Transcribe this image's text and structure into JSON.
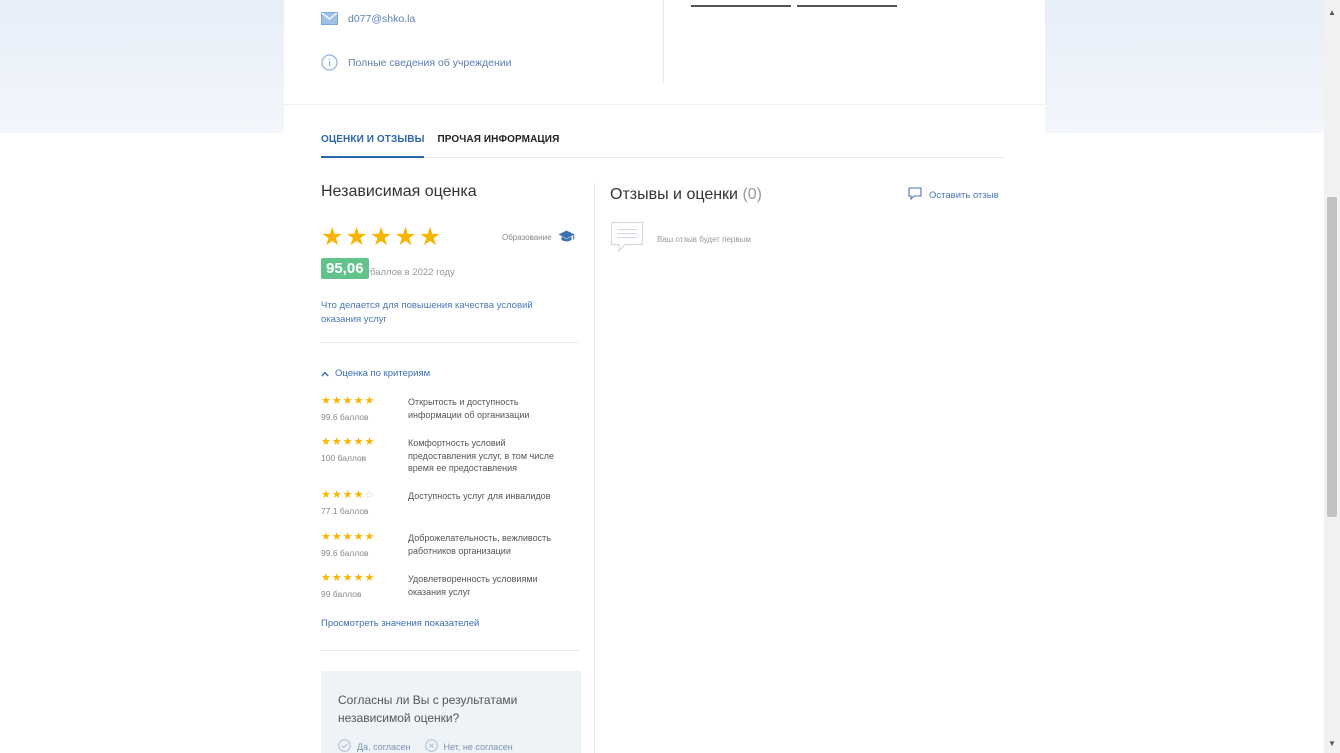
{
  "contact": {
    "email": "d077@shko.la",
    "full_info": "Полные сведения об учреждении"
  },
  "tabs": [
    {
      "label": "ОЦЕНКИ И ОТЗЫВЫ",
      "active": true
    },
    {
      "label": "ПРОЧАЯ ИНФОРМАЦИЯ",
      "active": false
    }
  ],
  "independent": {
    "title": "Независимая оценка",
    "stars": 5,
    "category": "Образование",
    "score": "95,06",
    "score_note": "баллов в 2022 году",
    "quality_link": "Что делается для повышения качества условий оказания услуг",
    "criteria_toggle": "Оценка по критериям",
    "criteria": [
      {
        "stars": 5,
        "points": "99.6 баллов",
        "name": "Открытость и доступность информации об организации"
      },
      {
        "stars": 5,
        "points": "100 баллов",
        "name": "Комфортность условий предоставления услуг, в том числе время ее предоставления"
      },
      {
        "stars": 4,
        "points": "77.1 баллов",
        "name": "Доступность услуг для инвалидов"
      },
      {
        "stars": 5,
        "points": "99.6 баллов",
        "name": "Доброжелательность, вежливость работников организации"
      },
      {
        "stars": 5,
        "points": "99 баллов",
        "name": "Удовлетворенность условиями оказания услуг"
      }
    ],
    "view_link": "Просмотреть значения показателей"
  },
  "agree": {
    "question": "Согласны ли Вы с результатами независимой оценки?",
    "yes": "Да, согласен",
    "no": "Нет, не согласен"
  },
  "reviews": {
    "title": "Отзывы и оценки",
    "count": "(0)",
    "leave_label": "Оставить отзыв",
    "empty_text": "Ваш отзыв будет первым"
  },
  "colors": {
    "accent": "#2b67ad",
    "link": "#4a78b3",
    "star": "#f7b500",
    "score_badge": "#62c38a"
  }
}
